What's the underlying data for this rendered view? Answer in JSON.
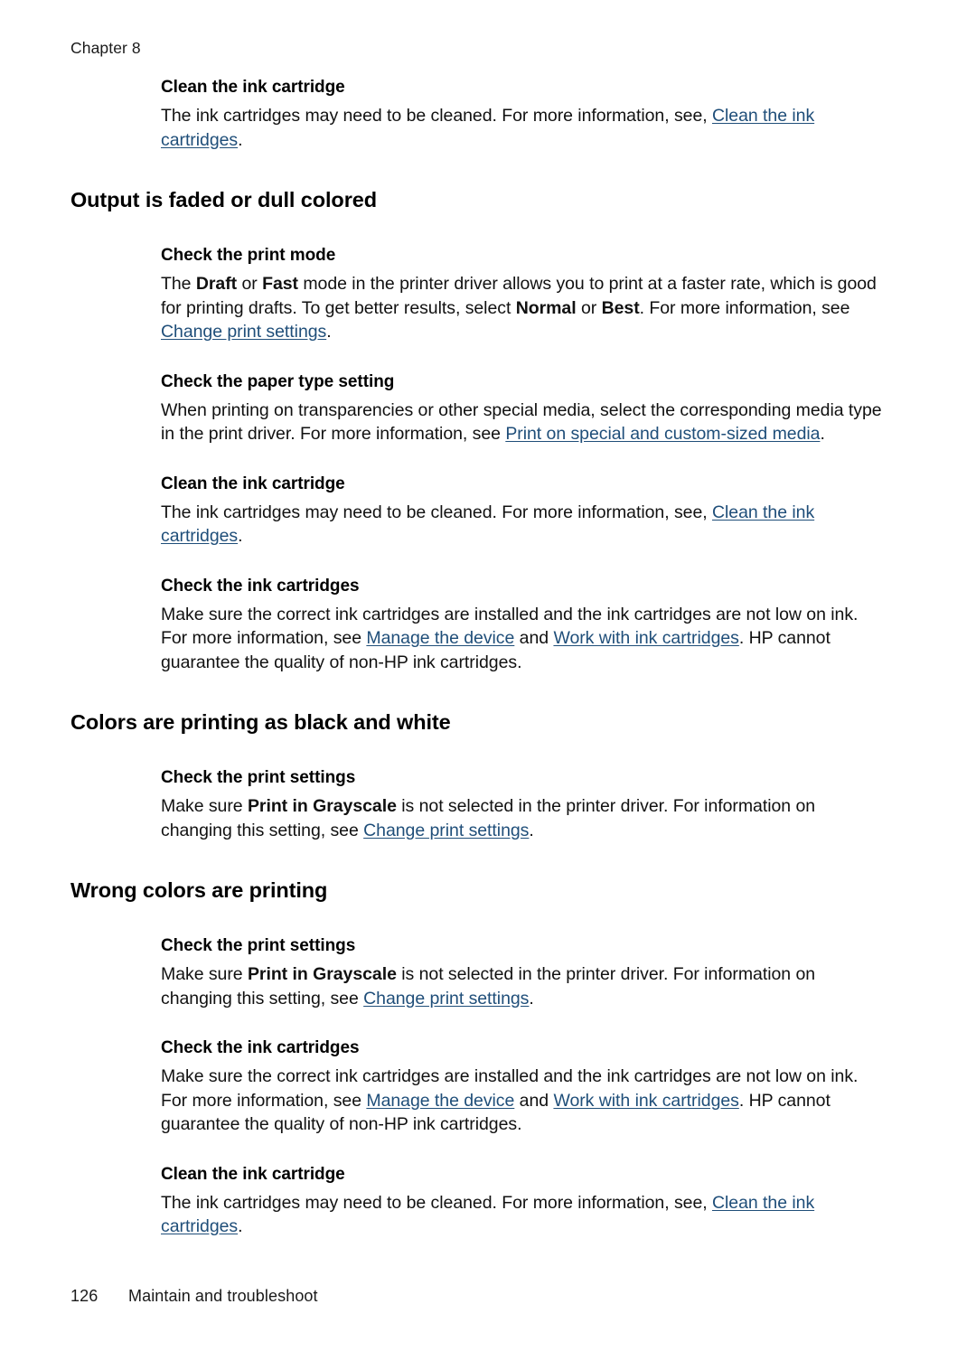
{
  "page": {
    "chapter_header": "Chapter 8",
    "footer_page_number": "126",
    "footer_title": "Maintain and troubleshoot",
    "link_color": "#1f4e79",
    "text_color": "#000000",
    "background_color": "#ffffff"
  },
  "blocks": [
    {
      "id": "clean-ink-cartridge-top",
      "type": "subsection",
      "heading": "Clean the ink cartridge",
      "paragraph": {
        "prefix": "The ink cartridges may need to be cleaned. For more information, see, ",
        "link": "Clean the ink cartridges",
        "suffix": "."
      }
    },
    {
      "id": "output-is-faded",
      "type": "section",
      "heading": "Output is faded or dull colored"
    },
    {
      "id": "check-print-mode",
      "type": "subsection",
      "heading": "Check the print mode",
      "paragraph": {
        "s1": "The ",
        "b1": "Draft",
        "s2": " or ",
        "b2": "Fast",
        "s3": " mode in the printer driver allows you to print at a faster rate, which is good for printing drafts. To get better results, select ",
        "b3": "Normal",
        "s4": " or ",
        "b4": "Best",
        "s5": ". For more information, see ",
        "link": "Change print settings",
        "suffix": "."
      }
    },
    {
      "id": "check-paper-type-setting",
      "type": "subsection",
      "heading": "Check the paper type setting",
      "paragraph": {
        "prefix": "When printing on transparencies or other special media, select the corresponding media type in the print driver. For more information, see ",
        "link": "Print on special and custom-sized media",
        "suffix": "."
      }
    },
    {
      "id": "clean-ink-cartridge-2",
      "type": "subsection",
      "heading": "Clean the ink cartridge",
      "paragraph": {
        "prefix": "The ink cartridges may need to be cleaned. For more information, see, ",
        "link": "Clean the ink cartridges",
        "suffix": "."
      }
    },
    {
      "id": "check-ink-cartridges-1",
      "type": "subsection",
      "heading": "Check the ink cartridges",
      "paragraph": {
        "prefix": "Make sure the correct ink cartridges are installed and the ink cartridges are not low on ink. For more information, see ",
        "link1": "Manage the device",
        "middle": " and ",
        "link2": "Work with ink cartridges",
        "suffix": ". HP cannot guarantee the quality of non-HP ink cartridges."
      }
    },
    {
      "id": "colors-printing-black-white",
      "type": "section",
      "heading": "Colors are printing as black and white"
    },
    {
      "id": "check-print-settings-1",
      "type": "subsection",
      "heading": "Check the print settings",
      "paragraph": {
        "prefix": "Make sure ",
        "bold": "Print in Grayscale",
        "middle": " is not selected in the printer driver. For information on changing this setting, see ",
        "link": "Change print settings",
        "suffix": "."
      }
    },
    {
      "id": "wrong-colors-printing",
      "type": "section",
      "heading": "Wrong colors are printing"
    },
    {
      "id": "check-print-settings-2",
      "type": "subsection",
      "heading": "Check the print settings",
      "paragraph": {
        "prefix": "Make sure ",
        "bold": "Print in Grayscale",
        "middle": " is not selected in the printer driver. For information on changing this setting, see ",
        "link": "Change print settings",
        "suffix": "."
      }
    },
    {
      "id": "check-ink-cartridges-2",
      "type": "subsection",
      "heading": "Check the ink cartridges",
      "paragraph": {
        "prefix": "Make sure the correct ink cartridges are installed and the ink cartridges are not low on ink. For more information, see ",
        "link1": "Manage the device",
        "middle": " and ",
        "link2": "Work with ink cartridges",
        "suffix": ". HP cannot guarantee the quality of non-HP ink cartridges."
      }
    },
    {
      "id": "clean-ink-cartridge-3",
      "type": "subsection",
      "heading": "Clean the ink cartridge",
      "paragraph": {
        "prefix": "The ink cartridges may need to be cleaned. For more information, see, ",
        "link": "Clean the ink cartridges",
        "suffix": "."
      }
    }
  ]
}
